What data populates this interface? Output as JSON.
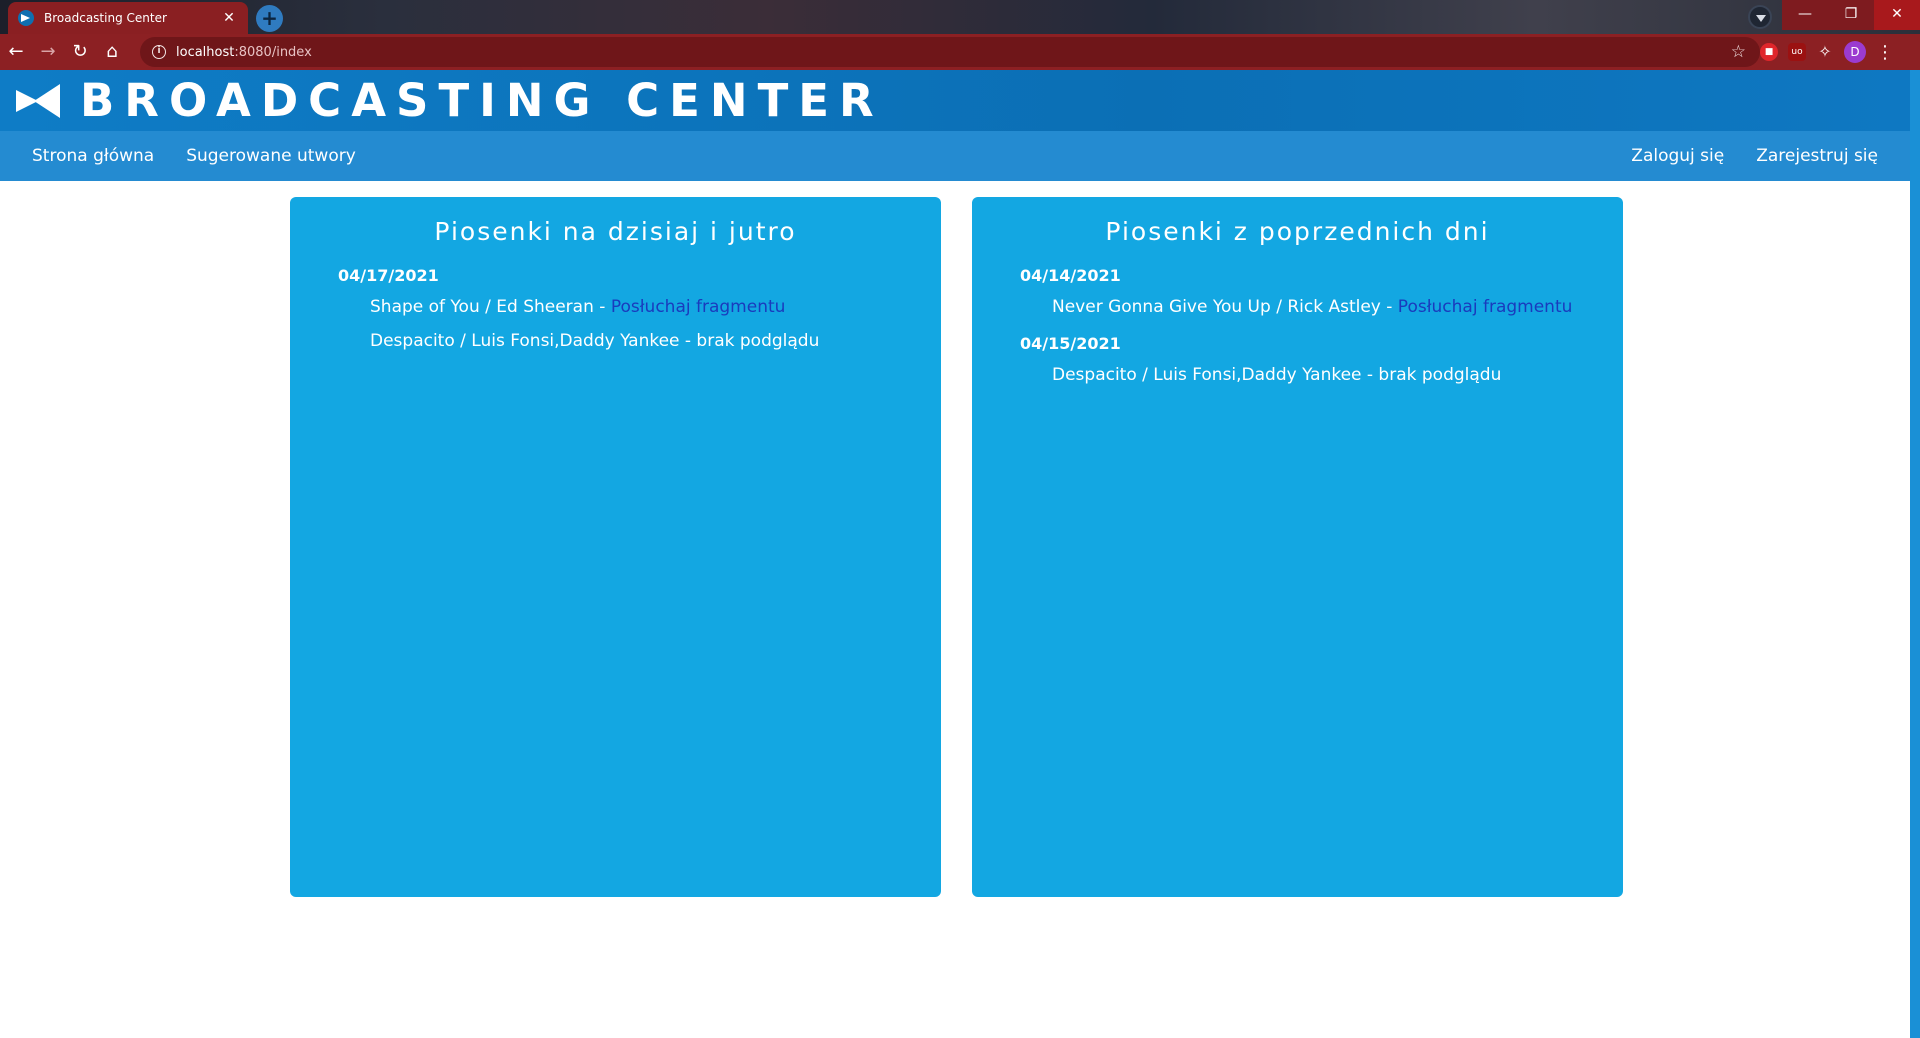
{
  "browser": {
    "tab_title": "Broadcasting Center",
    "tab_close": "✕",
    "new_tab": "+",
    "url_host": "localhost",
    "url_path": ":8080/index",
    "avatar_letter": "D"
  },
  "header": {
    "brand": "BROADCASTING CENTER"
  },
  "nav": {
    "home": "Strona główna",
    "suggested": "Sugerowane utwory",
    "login": "Zaloguj się",
    "register": "Zarejestruj się"
  },
  "today_card": {
    "title": "Piosenki na dzisiaj i jutro",
    "groups": [
      {
        "date": "04/17/2021",
        "songs": [
          {
            "text": "Shape of You / Ed Sheeran - ",
            "link": "Posłuchaj fragmentu"
          },
          {
            "text": "Despacito / Luis Fonsi,Daddy Yankee - brak podglądu",
            "link": ""
          }
        ]
      }
    ]
  },
  "previous_card": {
    "title": "Piosenki z poprzednich dni",
    "groups": [
      {
        "date": "04/14/2021",
        "songs": [
          {
            "text": "Never Gonna Give You Up / Rick Astley - ",
            "link": "Posłuchaj fragmentu"
          }
        ]
      },
      {
        "date": "04/15/2021",
        "songs": [
          {
            "text": "Despacito / Luis Fonsi,Daddy Yankee - brak podglądu",
            "link": ""
          }
        ]
      }
    ]
  },
  "colors": {
    "header_bg": "#0b6fb5",
    "nav_bg": "#248bd1",
    "card_bg": "#13a7e2",
    "link": "#1a3bbd",
    "browser_accent": "#8c2023"
  }
}
